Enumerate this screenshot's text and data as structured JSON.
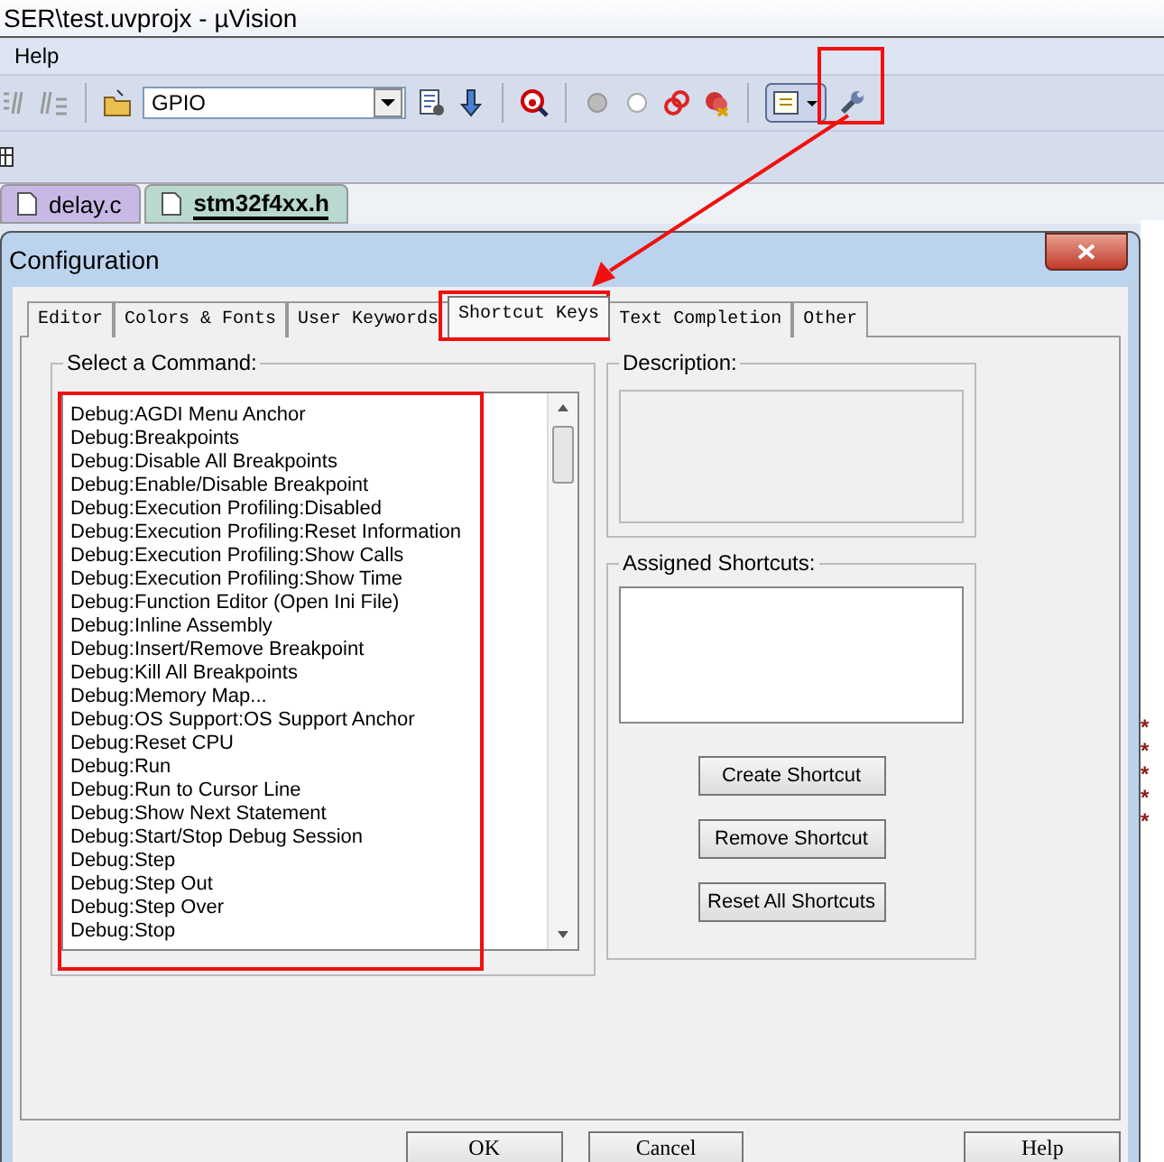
{
  "window": {
    "title": "SER\\test.uvprojx - µVision"
  },
  "menu": [
    "Help"
  ],
  "toolbar": {
    "target_combo": {
      "value": "GPIO"
    }
  },
  "file_tabs": [
    {
      "label": "delay.c",
      "selected": false
    },
    {
      "label": "stm32f4xx.h",
      "selected": true
    }
  ],
  "editor_marks": [
    "*",
    "*",
    "*",
    "*",
    "*"
  ],
  "dialog": {
    "title": "Configuration",
    "tabs": [
      {
        "label": "Editor",
        "selected": false
      },
      {
        "label": "Colors & Fonts",
        "selected": false
      },
      {
        "label": "User Keywords",
        "selected": false
      },
      {
        "label": "Shortcut Keys",
        "selected": true
      },
      {
        "label": "Text Completion",
        "selected": false
      },
      {
        "label": "Other",
        "selected": false
      }
    ],
    "command_group": {
      "label": "Select a Command:",
      "items": [
        "Debug:AGDI Menu Anchor",
        "Debug:Breakpoints",
        "Debug:Disable All Breakpoints",
        "Debug:Enable/Disable Breakpoint",
        "Debug:Execution Profiling:Disabled",
        "Debug:Execution Profiling:Reset Information",
        "Debug:Execution Profiling:Show Calls",
        "Debug:Execution Profiling:Show Time",
        "Debug:Function Editor (Open Ini File)",
        "Debug:Inline Assembly",
        "Debug:Insert/Remove Breakpoint",
        "Debug:Kill All Breakpoints",
        "Debug:Memory Map...",
        "Debug:OS Support:OS Support Anchor",
        "Debug:Reset CPU",
        "Debug:Run",
        "Debug:Run to Cursor Line",
        "Debug:Show Next Statement",
        "Debug:Start/Stop Debug Session",
        "Debug:Step",
        "Debug:Step Out",
        "Debug:Step Over",
        "Debug:Stop"
      ]
    },
    "description_group": {
      "label": "Description:"
    },
    "shortcuts_group": {
      "label": "Assigned Shortcuts:",
      "buttons": [
        "Create Shortcut",
        "Remove Shortcut",
        "Reset All Shortcuts"
      ]
    },
    "buttons": [
      "OK",
      "Cancel",
      "Help"
    ]
  }
}
